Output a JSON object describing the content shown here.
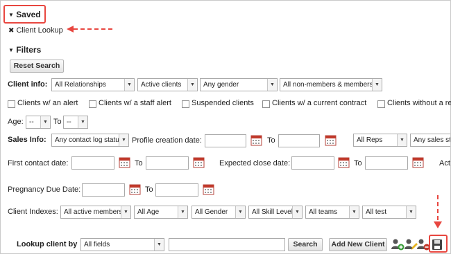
{
  "saved": {
    "title": "Saved",
    "item": "Client Lookup"
  },
  "filters": {
    "title": "Filters",
    "reset_label": "Reset Search"
  },
  "client_info": {
    "label": "Client info:",
    "relationships": "All Relationships",
    "status": "Active clients",
    "gender": "Any gender",
    "membership": "All non-members & members",
    "checkboxes": [
      "Clients w/ an alert",
      "Clients w/ a staff alert",
      "Suspended clients",
      "Clients w/ a current contract",
      "Clients without a re"
    ],
    "age_label": "Age:",
    "age_from": "--",
    "age_to_label": "To",
    "age_to": "--"
  },
  "sales_info": {
    "label": "Sales Info:",
    "contact_status": "Any contact log status",
    "profile_date_label": "Profile creation date:",
    "to_label": "To",
    "reps": "All Reps",
    "sales_stage": "Any sales stat"
  },
  "dates": {
    "first_contact_label": "First contact date:",
    "to_label": "To",
    "expected_close_label": "Expected close date:",
    "to_label2": "To",
    "cut_label": "Act",
    "pregnancy_label": "Pregnancy Due Date:",
    "to_label3": "To"
  },
  "indexes": {
    "label": "Client Indexes:",
    "members": "All active members",
    "age": "All Age",
    "gender": "All Gender",
    "skill": "All Skill Level",
    "teams": "All teams",
    "test": "All test"
  },
  "lookup": {
    "label": "Lookup client by",
    "field": "All fields",
    "search_value": "",
    "search_label": "Search",
    "add_label": "Add New Client"
  },
  "colors": {
    "annotation": "#e8463f",
    "calendar": "#c0392b"
  },
  "icons": [
    "chevron-down-icon",
    "remove-icon",
    "calendar-icon",
    "add-user-icon",
    "edit-user-icon",
    "delete-user-icon",
    "save-icon"
  ]
}
